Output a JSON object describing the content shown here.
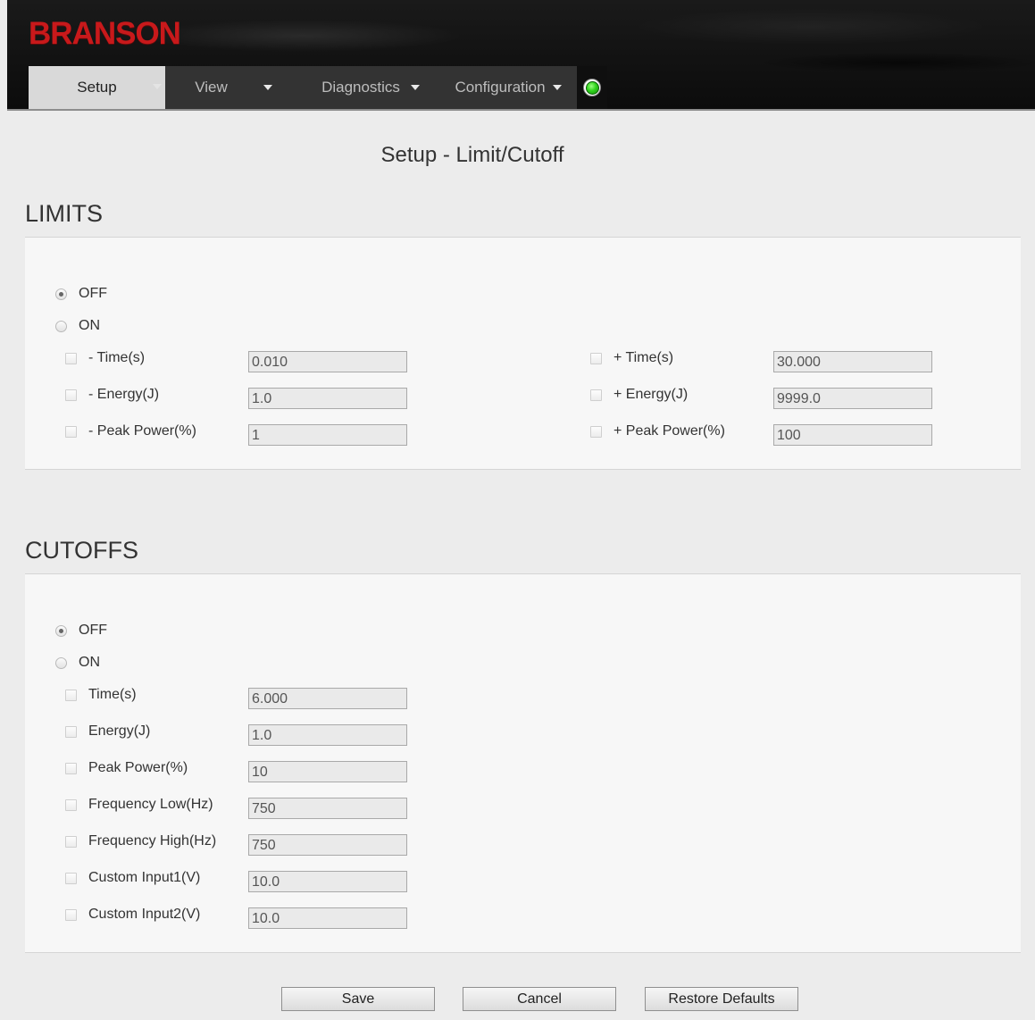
{
  "header": {
    "logo": "BRANSON",
    "nav": [
      {
        "label": "Setup"
      },
      {
        "label": "View"
      },
      {
        "label": "Diagnostics"
      },
      {
        "label": "Configuration"
      }
    ],
    "status_color": "#2fd41c"
  },
  "page_title": "Setup - Limit/Cutoff",
  "limits": {
    "title": "LIMITS",
    "radio_off": "OFF",
    "radio_on": "ON",
    "selected": "OFF",
    "left": [
      {
        "label": "- Time(s)",
        "value": "0.010"
      },
      {
        "label": "- Energy(J)",
        "value": "1.0"
      },
      {
        "label": "- Peak Power(%)",
        "value": "1"
      }
    ],
    "right": [
      {
        "label": "+ Time(s)",
        "value": "30.000"
      },
      {
        "label": "+ Energy(J)",
        "value": "9999.0"
      },
      {
        "label": "+ Peak Power(%)",
        "value": "100"
      }
    ]
  },
  "cutoffs": {
    "title": "CUTOFFS",
    "radio_off": "OFF",
    "radio_on": "ON",
    "selected": "OFF",
    "items": [
      {
        "label": "Time(s)",
        "value": "6.000"
      },
      {
        "label": "Energy(J)",
        "value": "1.0"
      },
      {
        "label": "Peak Power(%)",
        "value": "10"
      },
      {
        "label": "Frequency Low(Hz)",
        "value": "750"
      },
      {
        "label": "Frequency High(Hz)",
        "value": "750"
      },
      {
        "label": "Custom Input1(V)",
        "value": "10.0"
      },
      {
        "label": "Custom Input2(V)",
        "value": "10.0"
      }
    ]
  },
  "buttons": {
    "save": "Save",
    "cancel": "Cancel",
    "restore": "Restore Defaults"
  }
}
